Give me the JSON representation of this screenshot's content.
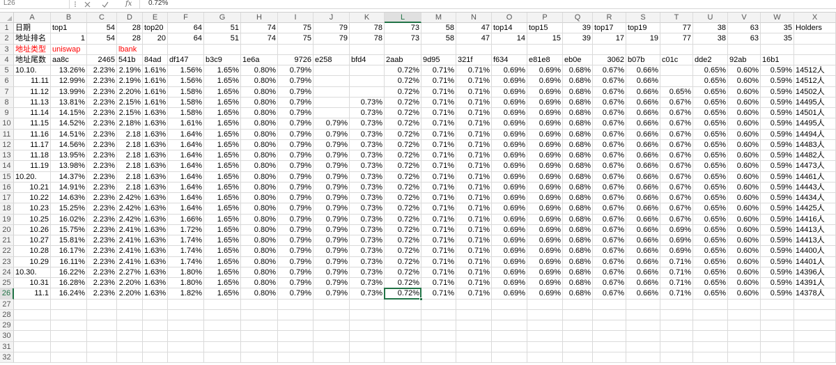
{
  "formula_bar": {
    "name_box": "L26",
    "fx_label": "fx",
    "formula_value": "0.72%"
  },
  "icons": {
    "separator": "vertical-dots-icon",
    "cancel": "cancel-icon",
    "enter": "enter-check-icon",
    "function": "insert-function-icon",
    "corner": "select-all-icon"
  },
  "sheet": {
    "colors": {
      "accent": "#217346",
      "red_text": "#ff0000",
      "gridline": "#dadada"
    },
    "red_cells": [
      "A3",
      "B3",
      "D3"
    ],
    "columns": [
      "A",
      "B",
      "C",
      "D",
      "E",
      "F",
      "G",
      "H",
      "I",
      "J",
      "K",
      "L",
      "M",
      "N",
      "O",
      "P",
      "Q",
      "R",
      "S",
      "T",
      "U",
      "V",
      "W",
      "X"
    ],
    "rows": [
      {
        "num": "1",
        "cells": [
          "日期",
          "top1",
          "54",
          "28",
          "top20",
          "64",
          "51",
          "74",
          "75",
          "79",
          "78",
          "73",
          "58",
          "47",
          "top14",
          "top15",
          "39",
          "top17",
          "top19",
          "77",
          "38",
          "63",
          "35",
          "Holders"
        ]
      },
      {
        "num": "2",
        "cells": [
          "地址排名",
          "1",
          "54",
          "28",
          "20",
          "64",
          "51",
          "74",
          "75",
          "79",
          "78",
          "73",
          "58",
          "47",
          "14",
          "15",
          "39",
          "17",
          "19",
          "77",
          "38",
          "63",
          "35",
          ""
        ]
      },
      {
        "num": "3",
        "cells": [
          "地址类型",
          "uniswap",
          "",
          "lbank",
          "",
          "",
          "",
          "",
          "",
          "",
          "",
          "",
          "",
          "",
          "",
          "",
          "",
          "",
          "",
          "",
          "",
          "",
          "",
          ""
        ]
      },
      {
        "num": "4",
        "cells": [
          "地址尾数",
          "aa8c",
          "2465",
          "541b",
          "84ad",
          "df147",
          "b3c9",
          "1e6a",
          "9726",
          "e258",
          "bfd4",
          "2aab",
          "9d95",
          "321f",
          "f634",
          "e81e8",
          "eb0e",
          "3062",
          "b07b",
          "c01c",
          "dde2",
          "92ab",
          "16b1",
          ""
        ]
      },
      {
        "num": "5",
        "cells": [
          "10.10.",
          "13.26%",
          "2.23%",
          "2.19%",
          "1.61%",
          "1.56%",
          "1.65%",
          "0.80%",
          "0.79%",
          "",
          "",
          "0.72%",
          "0.71%",
          "0.71%",
          "0.69%",
          "0.69%",
          "0.68%",
          "0.67%",
          "0.66%",
          "",
          "0.65%",
          "0.60%",
          "0.59%",
          "14512人"
        ]
      },
      {
        "num": "6",
        "cells": [
          "11.11",
          "12.99%",
          "2.23%",
          "2.19%",
          "1.61%",
          "1.56%",
          "1.65%",
          "0.80%",
          "0.79%",
          "",
          "",
          "0.72%",
          "0.71%",
          "0.71%",
          "0.69%",
          "0.69%",
          "0.68%",
          "0.67%",
          "0.66%",
          "",
          "0.65%",
          "0.60%",
          "0.59%",
          "14512人"
        ]
      },
      {
        "num": "7",
        "cells": [
          "11.12",
          "13.99%",
          "2.23%",
          "2.20%",
          "1.61%",
          "1.58%",
          "1.65%",
          "0.80%",
          "0.79%",
          "",
          "",
          "0.72%",
          "0.71%",
          "0.71%",
          "0.69%",
          "0.69%",
          "0.68%",
          "0.67%",
          "0.66%",
          "0.65%",
          "0.65%",
          "0.60%",
          "0.59%",
          "14502人"
        ]
      },
      {
        "num": "8",
        "cells": [
          "11.13",
          "13.81%",
          "2.23%",
          "2.15%",
          "1.61%",
          "1.58%",
          "1.65%",
          "0.80%",
          "0.79%",
          "",
          "0.73%",
          "0.72%",
          "0.71%",
          "0.71%",
          "0.69%",
          "0.69%",
          "0.68%",
          "0.67%",
          "0.66%",
          "0.67%",
          "0.65%",
          "0.60%",
          "0.59%",
          "14495人"
        ]
      },
      {
        "num": "9",
        "cells": [
          "11.14",
          "14.15%",
          "2.23%",
          "2.15%",
          "1.63%",
          "1.58%",
          "1.65%",
          "0.80%",
          "0.79%",
          "",
          "0.73%",
          "0.72%",
          "0.71%",
          "0.71%",
          "0.69%",
          "0.69%",
          "0.68%",
          "0.67%",
          "0.66%",
          "0.67%",
          "0.65%",
          "0.60%",
          "0.59%",
          "14501人"
        ]
      },
      {
        "num": "10",
        "cells": [
          "11.15",
          "14.52%",
          "2.23%",
          "2.18%",
          "1.63%",
          "1.61%",
          "1.65%",
          "0.80%",
          "0.79%",
          "0.79%",
          "0.73%",
          "0.72%",
          "0.71%",
          "0.71%",
          "0.69%",
          "0.69%",
          "0.68%",
          "0.67%",
          "0.66%",
          "0.67%",
          "0.65%",
          "0.60%",
          "0.59%",
          "14495人"
        ]
      },
      {
        "num": "11",
        "cells": [
          "11.16",
          "14.51%",
          "2.23%",
          "2.18",
          "1.63%",
          "1.64%",
          "1.65%",
          "0.80%",
          "0.79%",
          "0.79%",
          "0.73%",
          "0.72%",
          "0.71%",
          "0.71%",
          "0.69%",
          "0.69%",
          "0.68%",
          "0.67%",
          "0.66%",
          "0.67%",
          "0.65%",
          "0.60%",
          "0.59%",
          "14494人"
        ]
      },
      {
        "num": "12",
        "cells": [
          "11.17",
          "14.56%",
          "2.23%",
          "2.18",
          "1.63%",
          "1.64%",
          "1.65%",
          "0.80%",
          "0.79%",
          "0.79%",
          "0.73%",
          "0.72%",
          "0.71%",
          "0.71%",
          "0.69%",
          "0.69%",
          "0.68%",
          "0.67%",
          "0.66%",
          "0.67%",
          "0.65%",
          "0.60%",
          "0.59%",
          "14483人"
        ]
      },
      {
        "num": "13",
        "cells": [
          "11.18",
          "13.95%",
          "2.23%",
          "2.18",
          "1.63%",
          "1.64%",
          "1.65%",
          "0.80%",
          "0.79%",
          "0.79%",
          "0.73%",
          "0.72%",
          "0.71%",
          "0.71%",
          "0.69%",
          "0.69%",
          "0.68%",
          "0.67%",
          "0.66%",
          "0.67%",
          "0.65%",
          "0.60%",
          "0.59%",
          "14482人"
        ]
      },
      {
        "num": "14",
        "cells": [
          "11.19",
          "13.98%",
          "2.23%",
          "2.18",
          "1.63%",
          "1.64%",
          "1.65%",
          "0.80%",
          "0.79%",
          "0.79%",
          "0.73%",
          "0.72%",
          "0.71%",
          "0.71%",
          "0.69%",
          "0.69%",
          "0.68%",
          "0.67%",
          "0.66%",
          "0.67%",
          "0.65%",
          "0.60%",
          "0.59%",
          "14473人"
        ]
      },
      {
        "num": "15",
        "cells": [
          "10.20.",
          "14.37%",
          "2.23%",
          "2.18",
          "1.63%",
          "1.64%",
          "1.65%",
          "0.80%",
          "0.79%",
          "0.79%",
          "0.73%",
          "0.72%",
          "0.71%",
          "0.71%",
          "0.69%",
          "0.69%",
          "0.68%",
          "0.67%",
          "0.66%",
          "0.67%",
          "0.65%",
          "0.60%",
          "0.59%",
          "14461人"
        ]
      },
      {
        "num": "16",
        "cells": [
          "10.21",
          "14.91%",
          "2.23%",
          "2.18",
          "1.63%",
          "1.64%",
          "1.65%",
          "0.80%",
          "0.79%",
          "0.79%",
          "0.73%",
          "0.72%",
          "0.71%",
          "0.71%",
          "0.69%",
          "0.69%",
          "0.68%",
          "0.67%",
          "0.66%",
          "0.67%",
          "0.65%",
          "0.60%",
          "0.59%",
          "14443人"
        ]
      },
      {
        "num": "17",
        "cells": [
          "10.22",
          "14.63%",
          "2.23%",
          "2.42%",
          "1.63%",
          "1.64%",
          "1.65%",
          "0.80%",
          "0.79%",
          "0.79%",
          "0.73%",
          "0.72%",
          "0.71%",
          "0.71%",
          "0.69%",
          "0.69%",
          "0.68%",
          "0.67%",
          "0.66%",
          "0.67%",
          "0.65%",
          "0.60%",
          "0.59%",
          "14434人"
        ]
      },
      {
        "num": "18",
        "cells": [
          "10.23",
          "15.25%",
          "2.23%",
          "2.42%",
          "1.63%",
          "1.64%",
          "1.65%",
          "0.80%",
          "0.79%",
          "0.79%",
          "0.73%",
          "0.72%",
          "0.71%",
          "0.71%",
          "0.69%",
          "0.69%",
          "0.68%",
          "0.67%",
          "0.66%",
          "0.67%",
          "0.65%",
          "0.60%",
          "0.59%",
          "14425人"
        ]
      },
      {
        "num": "19",
        "cells": [
          "10.25",
          "16.02%",
          "2.23%",
          "2.42%",
          "1.63%",
          "1.66%",
          "1.65%",
          "0.80%",
          "0.79%",
          "0.79%",
          "0.73%",
          "0.72%",
          "0.71%",
          "0.71%",
          "0.69%",
          "0.69%",
          "0.68%",
          "0.67%",
          "0.66%",
          "0.67%",
          "0.65%",
          "0.60%",
          "0.59%",
          "14416人"
        ]
      },
      {
        "num": "20",
        "cells": [
          "10.26",
          "15.75%",
          "2.23%",
          "2.41%",
          "1.63%",
          "1.72%",
          "1.65%",
          "0.80%",
          "0.79%",
          "0.79%",
          "0.73%",
          "0.72%",
          "0.71%",
          "0.71%",
          "0.69%",
          "0.69%",
          "0.68%",
          "0.67%",
          "0.66%",
          "0.69%",
          "0.65%",
          "0.60%",
          "0.59%",
          "14413人"
        ]
      },
      {
        "num": "21",
        "cells": [
          "10.27",
          "15.81%",
          "2.23%",
          "2.41%",
          "1.63%",
          "1.74%",
          "1.65%",
          "0.80%",
          "0.79%",
          "0.79%",
          "0.73%",
          "0.72%",
          "0.71%",
          "0.71%",
          "0.69%",
          "0.69%",
          "0.68%",
          "0.67%",
          "0.66%",
          "0.69%",
          "0.65%",
          "0.60%",
          "0.59%",
          "14413人"
        ]
      },
      {
        "num": "22",
        "cells": [
          "10.28",
          "16.17%",
          "2.23%",
          "2.41%",
          "1.63%",
          "1.74%",
          "1.65%",
          "0.80%",
          "0.79%",
          "0.79%",
          "0.73%",
          "0.72%",
          "0.71%",
          "0.71%",
          "0.69%",
          "0.69%",
          "0.68%",
          "0.67%",
          "0.66%",
          "0.69%",
          "0.65%",
          "0.60%",
          "0.59%",
          "14400人"
        ]
      },
      {
        "num": "23",
        "cells": [
          "10.29",
          "16.11%",
          "2.23%",
          "2.41%",
          "1.63%",
          "1.74%",
          "1.65%",
          "0.80%",
          "0.79%",
          "0.79%",
          "0.73%",
          "0.72%",
          "0.71%",
          "0.71%",
          "0.69%",
          "0.69%",
          "0.68%",
          "0.67%",
          "0.66%",
          "0.71%",
          "0.65%",
          "0.60%",
          "0.59%",
          "14401人"
        ]
      },
      {
        "num": "24",
        "cells": [
          "10.30.",
          "16.22%",
          "2.23%",
          "2.27%",
          "1.63%",
          "1.80%",
          "1.65%",
          "0.80%",
          "0.79%",
          "0.79%",
          "0.73%",
          "0.72%",
          "0.71%",
          "0.71%",
          "0.69%",
          "0.69%",
          "0.68%",
          "0.67%",
          "0.66%",
          "0.71%",
          "0.65%",
          "0.60%",
          "0.59%",
          "14396人"
        ]
      },
      {
        "num": "25",
        "cells": [
          "10.31",
          "16.28%",
          "2.23%",
          "2.20%",
          "1.63%",
          "1.80%",
          "1.65%",
          "0.80%",
          "0.79%",
          "0.79%",
          "0.73%",
          "0.72%",
          "0.71%",
          "0.71%",
          "0.69%",
          "0.69%",
          "0.68%",
          "0.67%",
          "0.66%",
          "0.71%",
          "0.65%",
          "0.60%",
          "0.59%",
          "14391人"
        ]
      },
      {
        "num": "26",
        "cells": [
          "11.1",
          "16.24%",
          "2.23%",
          "2.20%",
          "1.63%",
          "1.82%",
          "1.65%",
          "0.80%",
          "0.79%",
          "0.79%",
          "0.73%",
          "0.72%",
          "0.71%",
          "0.71%",
          "0.69%",
          "0.69%",
          "0.68%",
          "0.67%",
          "0.66%",
          "0.71%",
          "0.65%",
          "0.60%",
          "0.59%",
          "14378人"
        ]
      },
      {
        "num": "27",
        "cells": []
      },
      {
        "num": "28",
        "cells": []
      },
      {
        "num": "29",
        "cells": []
      },
      {
        "num": "30",
        "cells": []
      },
      {
        "num": "31",
        "cells": []
      },
      {
        "num": "32",
        "cells": []
      }
    ]
  }
}
